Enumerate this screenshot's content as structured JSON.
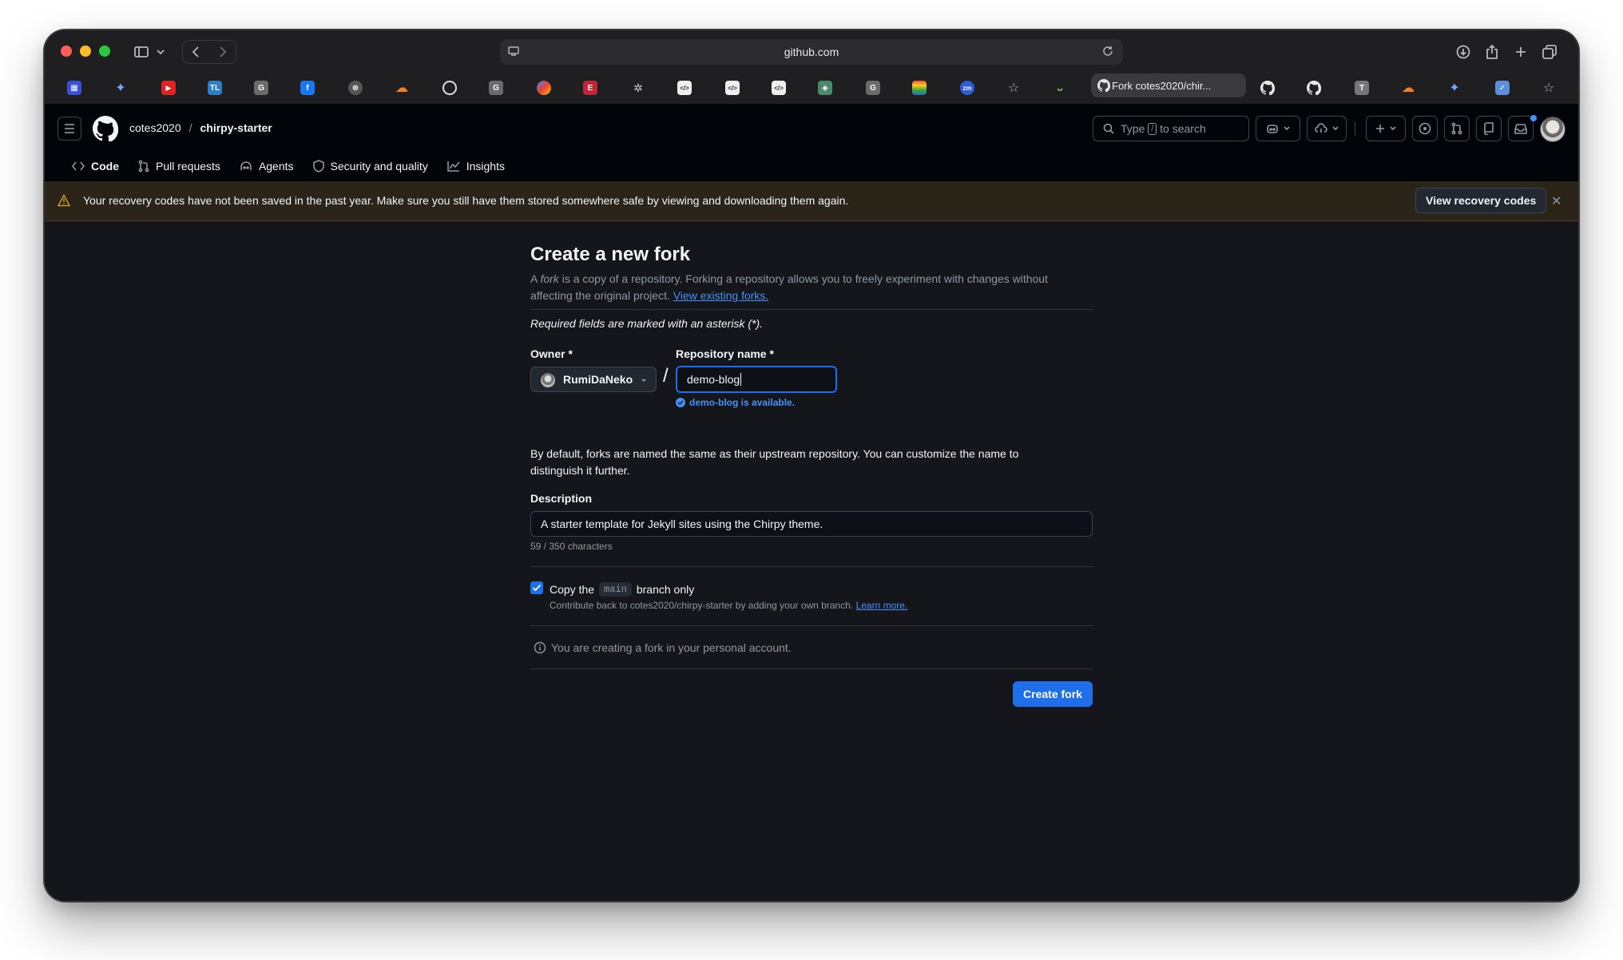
{
  "browser": {
    "url": "github.com",
    "active_tab_title": "Fork cotes2020/chir..."
  },
  "header": {
    "owner": "cotes2020",
    "separator": "/",
    "repo": "chirpy-starter",
    "search_prefix": "Type",
    "search_key": "/",
    "search_suffix": "to search"
  },
  "repo_nav": {
    "code": "Code",
    "pull_requests": "Pull requests",
    "agents": "Agents",
    "security": "Security and quality",
    "insights": "Insights"
  },
  "banner": {
    "message": "Your recovery codes have not been saved in the past year. Make sure you still have them stored somewhere safe by viewing and downloading them again.",
    "button": "View recovery codes",
    "close": "✕"
  },
  "form": {
    "title": "Create a new fork",
    "intro_a": "A",
    "intro_fork": "fork",
    "intro_b": "is a copy of a repository. Forking a repository allows you to freely experiment with changes without affecting the original project.",
    "intro_link": "View existing forks.",
    "required_note": "Required fields are marked with an asterisk (*).",
    "owner_label": "Owner *",
    "owner_value": "RumiDaNeko",
    "repo_label": "Repository name *",
    "repo_value": "demo-blog",
    "availability": "demo-blog is available.",
    "naming_note": "By default, forks are named the same as their upstream repository. You can customize the name to distinguish it further.",
    "description_label": "Description",
    "description_value": "A starter template for Jekyll sites using the Chirpy theme.",
    "char_count": "59 / 350 characters",
    "copy_label_a": "Copy the",
    "copy_label_branch": "main",
    "copy_label_b": "branch only",
    "copy_hint": "Contribute back to cotes2020/chirpy-starter by adding your own branch.",
    "copy_hint_link": "Learn more.",
    "account_note": "You are creating a fork in your personal account.",
    "submit": "Create fork"
  }
}
